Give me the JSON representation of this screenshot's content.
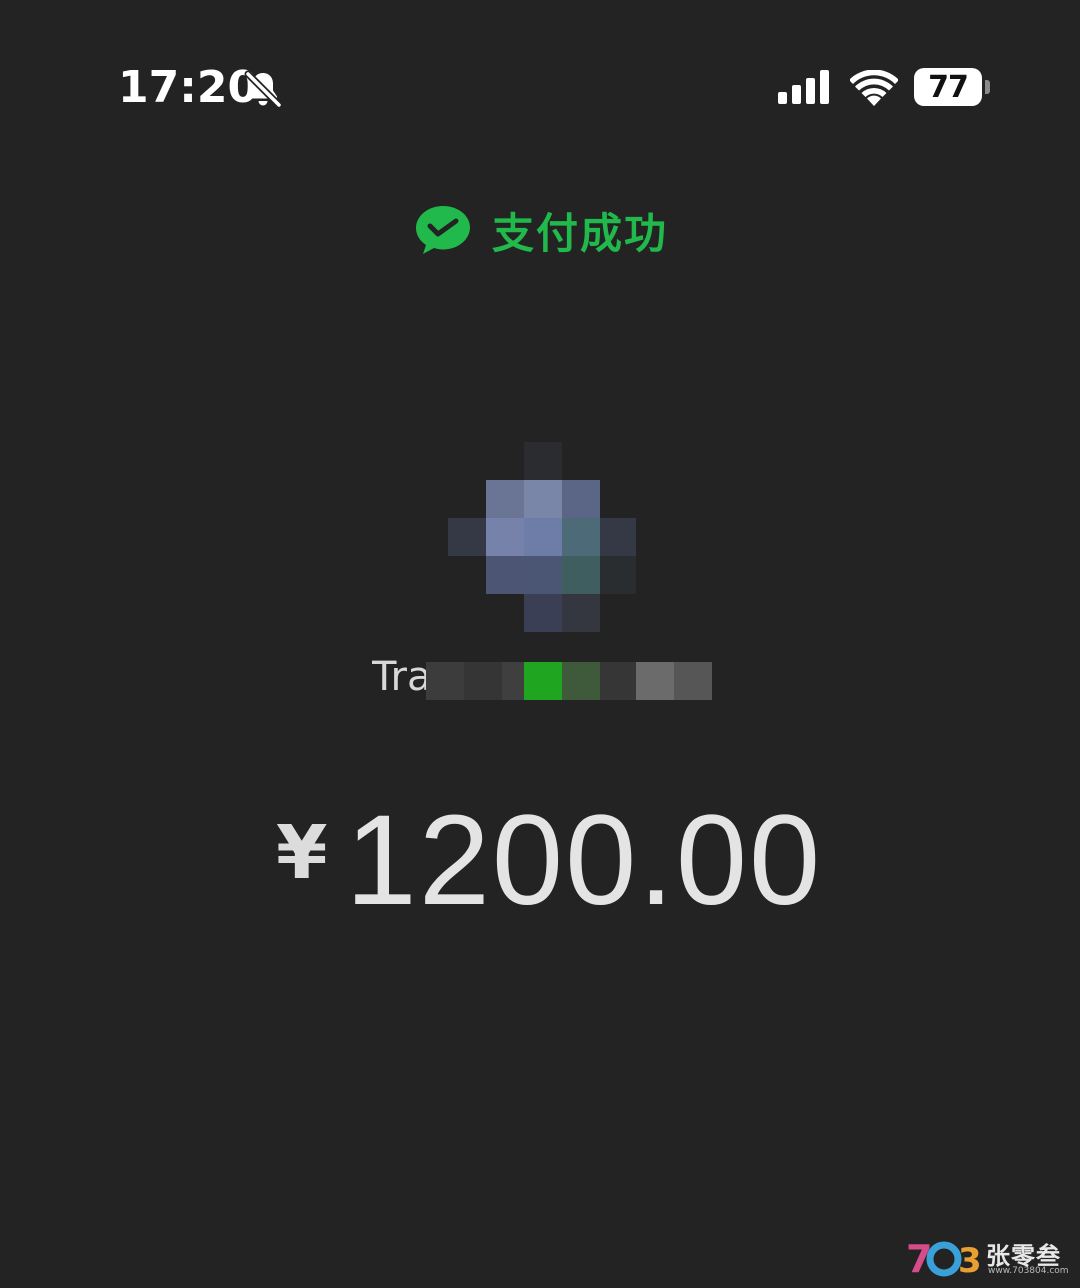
{
  "status_bar": {
    "time": "17:20",
    "battery_level": "77",
    "icons": [
      "bell-slash-icon",
      "cellular-signal-icon",
      "wifi-icon",
      "battery-icon"
    ]
  },
  "payment": {
    "status_title": "支付成功",
    "icon": "wechat-pay-icon",
    "accent_color": "#21b94c"
  },
  "merchant": {
    "name_visible_prefix": "Tra",
    "avatar": "pixelated-merchant-avatar",
    "name_obscured": true
  },
  "amount": {
    "currency_symbol": "¥",
    "value": "1200.00"
  },
  "watermark": {
    "logo_text": "703",
    "name": "张零叁",
    "url": "www.703804.com"
  }
}
